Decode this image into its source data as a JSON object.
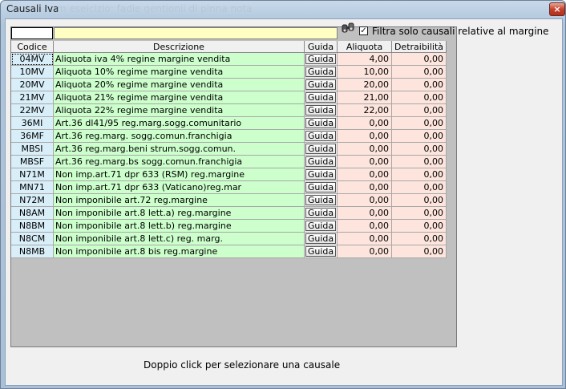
{
  "window": {
    "title": "Causali Iva",
    "ghost_title": "m eseicizio: fadie gentionii di pinna nota",
    "close_glyph": "×"
  },
  "filter": {
    "checkbox_label": "Filtra solo causali relative al margine",
    "checked": true,
    "check_glyph": "✓"
  },
  "columns": {
    "code": "Codice",
    "desc": "Descrizione",
    "guida": "Guida",
    "aliquota": "Aliquota",
    "detraibilita": "Detraibilità"
  },
  "rows": [
    {
      "code": "04MV",
      "desc": "Aliquota iva 4% regine margine vendita",
      "guida": "Guida",
      "aliquota": "4,00",
      "detraibilita": "0,00"
    },
    {
      "code": "10MV",
      "desc": "Aliquota 10% regime margine vendita",
      "guida": "Guida",
      "aliquota": "10,00",
      "detraibilita": "0,00"
    },
    {
      "code": "20MV",
      "desc": "Aliquota 20% regime margine vendita",
      "guida": "Guida",
      "aliquota": "20,00",
      "detraibilita": "0,00"
    },
    {
      "code": "21MV",
      "desc": "Aliquota 21% regime margine vendita",
      "guida": "Guida",
      "aliquota": "21,00",
      "detraibilita": "0,00"
    },
    {
      "code": "22MV",
      "desc": "Aliquota 22% regime margine vendita",
      "guida": "Guida",
      "aliquota": "22,00",
      "detraibilita": "0,00"
    },
    {
      "code": "36MI",
      "desc": "Art.36 dl41/95 reg.marg.sogg.comunitario",
      "guida": "Guida",
      "aliquota": "0,00",
      "detraibilita": "0,00"
    },
    {
      "code": "36MF",
      "desc": "Art.36 reg.marg. sogg.comun.franchigia",
      "guida": "Guida",
      "aliquota": "0,00",
      "detraibilita": "0,00"
    },
    {
      "code": "MBSI",
      "desc": "Art.36  reg.marg.beni strum.sogg.comun.",
      "guida": "Guida",
      "aliquota": "0,00",
      "detraibilita": "0,00"
    },
    {
      "code": "MBSF",
      "desc": "Art.36 reg.marg.bs sogg.comun.franchigia",
      "guida": "Guida",
      "aliquota": "0,00",
      "detraibilita": "0,00"
    },
    {
      "code": "N71M",
      "desc": "Non imp.art.71 dpr 633 (RSM) reg.margine",
      "guida": "Guida",
      "aliquota": "0,00",
      "detraibilita": "0,00"
    },
    {
      "code": "MN71",
      "desc": "Non imp.art.71 dpr 633 (Vaticano)reg.mar",
      "guida": "Guida",
      "aliquota": "0,00",
      "detraibilita": "0,00"
    },
    {
      "code": "N72M",
      "desc": "Non imponibile art.72 reg.margine",
      "guida": "Guida",
      "aliquota": "0,00",
      "detraibilita": "0,00"
    },
    {
      "code": "N8AM",
      "desc": "Non imponibile art.8 lett.a) reg.margine",
      "guida": "Guida",
      "aliquota": "0,00",
      "detraibilita": "0,00"
    },
    {
      "code": "N8BM",
      "desc": "Non imponibile art.8 lett.b) reg.margine",
      "guida": "Guida",
      "aliquota": "0,00",
      "detraibilita": "0,00"
    },
    {
      "code": "N8CM",
      "desc": "Non imponibile art.8 lett.c) reg. marg.",
      "guida": "Guida",
      "aliquota": "0,00",
      "detraibilita": "0,00"
    },
    {
      "code": "N8MB",
      "desc": "Non imponibile art.8 bis reg.margine",
      "guida": "Guida",
      "aliquota": "0,00",
      "detraibilita": "0,00"
    }
  ],
  "footer": {
    "hint": "Doppio click per selezionare una causale"
  },
  "colors": {
    "code_bg": "#d8eef9",
    "desc_bg": "#ccffcc",
    "num_bg": "#fde5dd",
    "filter_bg": "#ffffc4",
    "grid_empty": "#c0c0c0"
  },
  "icons": {
    "filter_icon": "binoculars-icon"
  }
}
